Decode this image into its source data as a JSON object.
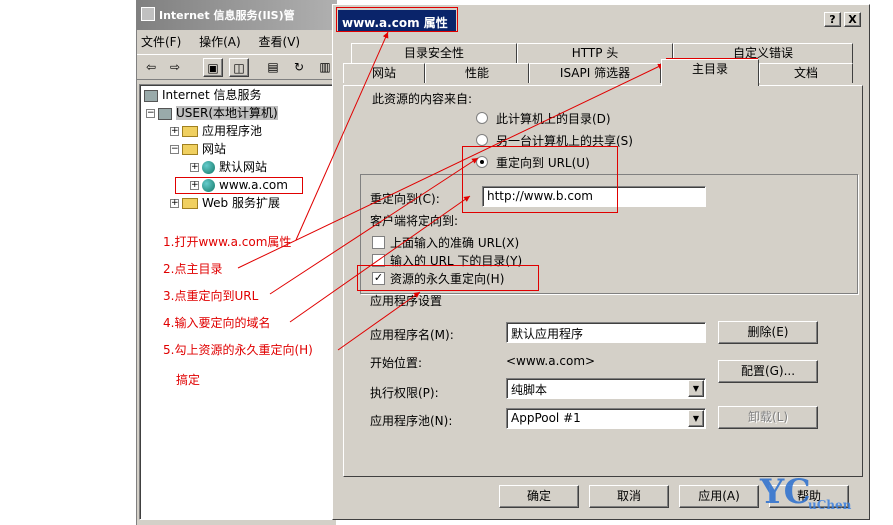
{
  "mmc": {
    "title": "Internet 信息服务(IIS)管",
    "menu": [
      "文件(F)",
      "操作(A)",
      "查看(V)"
    ],
    "toolbar_icons": [
      "back-arrow-icon",
      "forward-arrow-icon",
      "up-folder-icon",
      "show-tree-icon",
      "properties-icon",
      "refresh-icon",
      "export-icon"
    ],
    "tree": {
      "root": "Internet 信息服务",
      "computer": "USER(本地计算机)",
      "app_pools": "应用程序池",
      "websites": "网站",
      "default_site": "默认网站",
      "site": "www.a.com",
      "web_ext": "Web 服务扩展"
    }
  },
  "dialog": {
    "title": "www.a.com 属性",
    "help_btn": "?",
    "close_btn": "X",
    "tabs_back": [
      "目录安全性",
      "HTTP 头",
      "自定义错误"
    ],
    "tabs_front": [
      "网站",
      "性能",
      "ISAPI 筛选器",
      "主目录",
      "文档"
    ],
    "content_source_label": "此资源的内容来自:",
    "radio_local": "此计算机上的目录(D)",
    "radio_share": "另一台计算机上的共享(S)",
    "radio_url": "重定向到 URL(U)",
    "redirect_label": "重定向到(C):",
    "redirect_value": "http://www.b.com",
    "client_redirect_label": "客户端将定向到:",
    "chk_exact": "上面输入的准确 URL(X)",
    "chk_below": "输入的 URL 下的目录(Y)",
    "chk_permanent": "资源的永久重定向(H)",
    "app_settings_label": "应用程序设置",
    "app_name_label": "应用程序名(M):",
    "app_name_value": "默认应用程序",
    "remove_btn": "删除(E)",
    "start_label": "开始位置:",
    "start_value": "<www.a.com>",
    "config_btn": "配置(G)...",
    "exec_label": "执行权限(P):",
    "exec_value": "纯脚本",
    "pool_label": "应用程序池(N):",
    "pool_value": "AppPool #1",
    "unload_btn": "卸载(L)",
    "ok_btn": "确定",
    "cancel_btn": "取消",
    "apply_btn": "应用(A)",
    "help_btn2": "帮助"
  },
  "annotations": {
    "step1": "1.打开www.a.com属性",
    "step2": "2.点主目录",
    "step3": "3.点重定向到URL",
    "step4": "4.输入要定向的域名",
    "step5": "5.勾上资源的永久重定向(H)",
    "done": "搞定"
  },
  "logo": {
    "big": "YC",
    "small": "uChen"
  },
  "colors": {
    "annotation": "#e00000",
    "titlebar": "#0a246a",
    "face": "#d4d0c8"
  }
}
